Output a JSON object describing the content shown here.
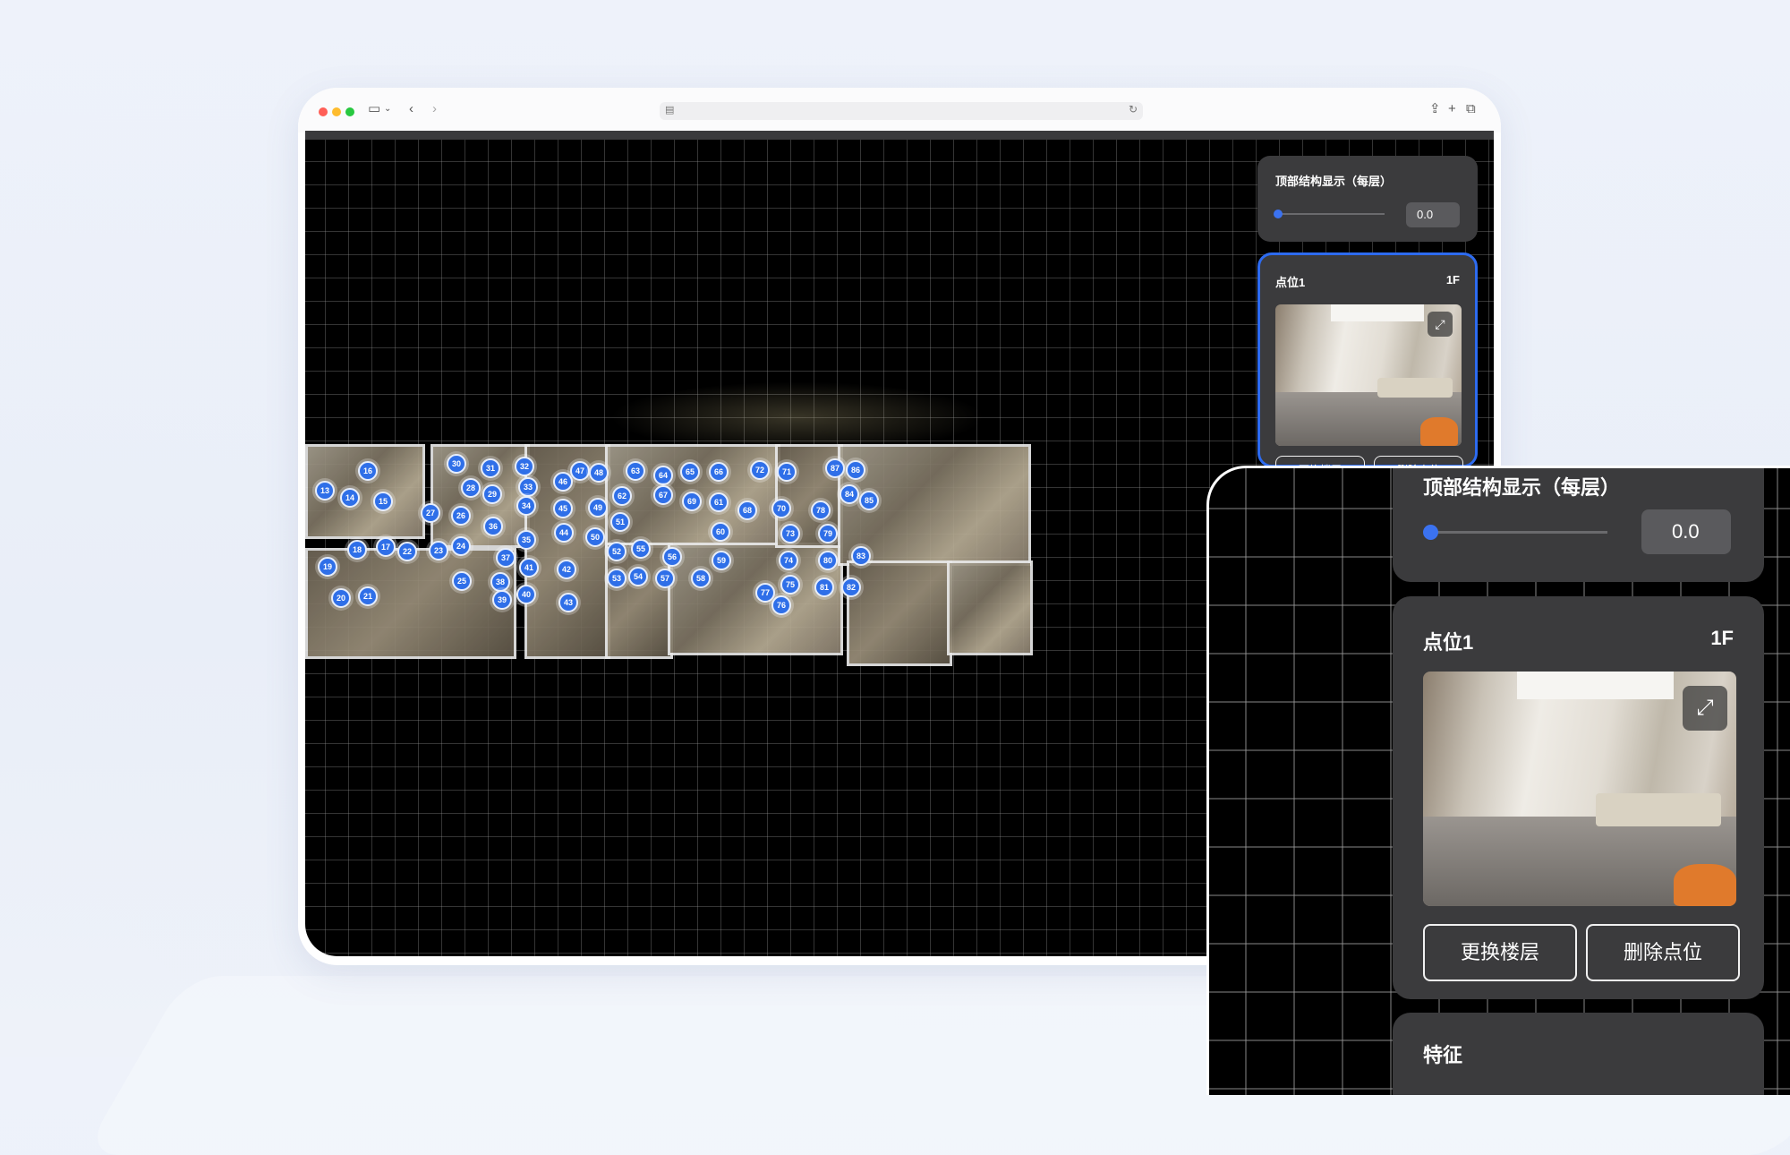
{
  "browser": {
    "traffic_lights": [
      "#ff5f57",
      "#febc2e",
      "#28c840"
    ],
    "icons": [
      "sidebar-icon",
      "chevron-down-icon",
      "back-icon",
      "forward-icon",
      "share-icon",
      "new-tab-icon",
      "tabs-icon"
    ]
  },
  "map": {
    "points": [
      "13",
      "14",
      "15",
      "16",
      "17",
      "18",
      "19",
      "20",
      "21",
      "22",
      "23",
      "24",
      "25",
      "26",
      "27",
      "28",
      "29",
      "30",
      "31",
      "32",
      "33",
      "34",
      "35",
      "36",
      "37",
      "38",
      "39",
      "40",
      "41",
      "42",
      "43",
      "44",
      "45",
      "46",
      "47",
      "48",
      "49",
      "50",
      "51",
      "52",
      "53",
      "54",
      "55",
      "56",
      "57",
      "58",
      "59",
      "60",
      "61",
      "62",
      "63",
      "64",
      "65",
      "66",
      "67",
      "68",
      "69",
      "70",
      "71",
      "72",
      "73",
      "74",
      "75",
      "76",
      "77",
      "78",
      "79",
      "80",
      "81",
      "82",
      "83",
      "84",
      "85",
      "86",
      "87"
    ]
  },
  "top_panel": {
    "title": "顶部结构显示（每层）",
    "value": "0.0",
    "slider_fraction": 0
  },
  "point_card": {
    "title": "点位1",
    "floor": "1F",
    "change_floor_label": "更换楼层",
    "delete_label": "删除点位"
  },
  "zoom": {
    "top_title": "顶部结构显示（每层）",
    "value": "0.0",
    "point_title": "点位1",
    "floor": "1F",
    "change_floor_label": "更换楼层",
    "delete_label": "删除点位",
    "features_title": "特征"
  },
  "colors": {
    "accent": "#3b72f0",
    "panel": "#3b3b3d",
    "card_border": "#2d6bf0"
  }
}
